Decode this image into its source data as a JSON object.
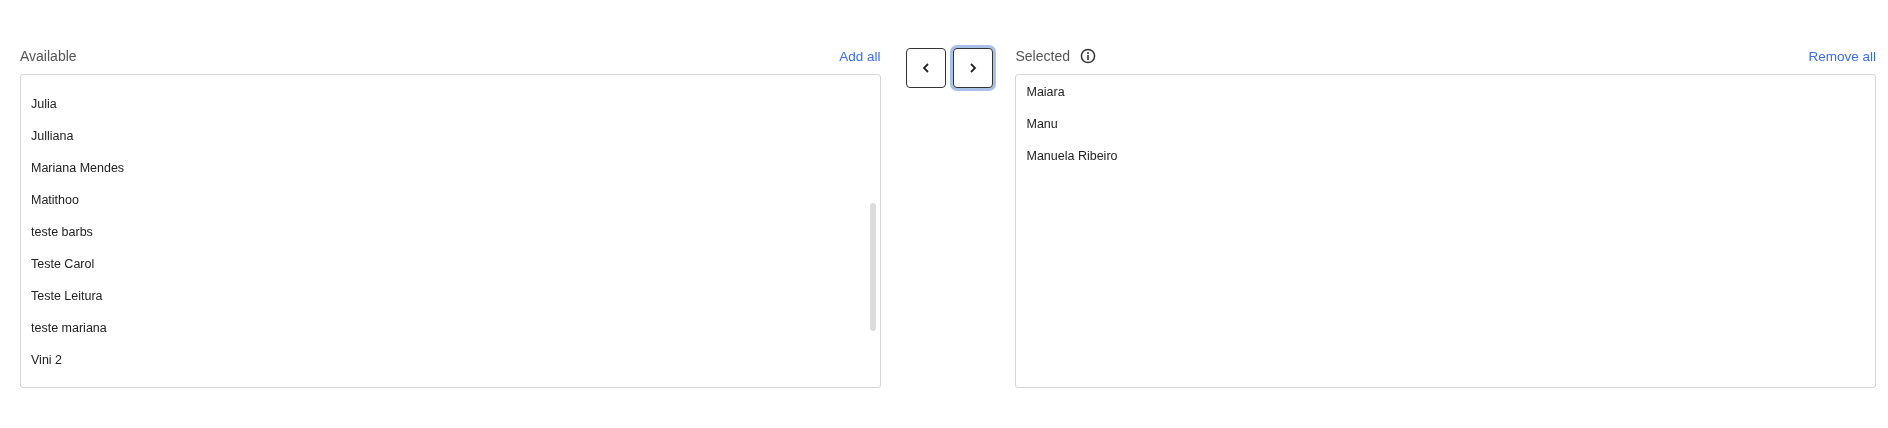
{
  "available": {
    "label": "Available",
    "action": "Add all",
    "items": [
      {
        "label": "Julia"
      },
      {
        "label": "Julliana"
      },
      {
        "label": "Mariana Mendes"
      },
      {
        "label": "Matithoo"
      },
      {
        "label": "teste barbs"
      },
      {
        "label": "Teste Carol"
      },
      {
        "label": "Teste Leitura"
      },
      {
        "label": "teste mariana"
      },
      {
        "label": "Vini 2"
      }
    ]
  },
  "move_buttons": [
    {
      "kind": "left",
      "focused": false
    },
    {
      "kind": "right",
      "focused": true
    }
  ],
  "selected": {
    "label": "Selected",
    "action": "Remove all",
    "items": [
      {
        "label": "Maiara"
      },
      {
        "label": "Manu"
      },
      {
        "label": "Manuela Ribeiro"
      }
    ]
  }
}
